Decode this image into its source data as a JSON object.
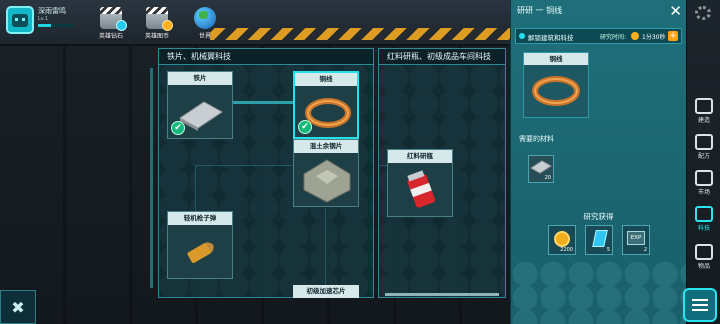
{
  "player": {
    "name": "深雨雷鸣",
    "level": "Lv.1",
    "xp_fraction": 0.35
  },
  "topbar": [
    {
      "label": "英雄钻石",
      "icon": "clapperboard-diamond-icon"
    },
    {
      "label": "英雄图币",
      "icon": "clapperboard-coin-icon"
    },
    {
      "label": "世界",
      "icon": "globe-icon"
    }
  ],
  "panels": {
    "left_title": "铁片、机械翼科技",
    "right_title": "红料研瓶、初级成品车间科技"
  },
  "nodes": {
    "iron_sheet": "铁片",
    "wire": "铜线",
    "concrete": "混土余钢片",
    "bullet": "轻机枪子弹",
    "accel": "初级加速芯片",
    "red_bottle": "红料研瓶"
  },
  "detail": {
    "title": "研研 一 铜线",
    "unlock_label": "解锁建筑和科技",
    "time_label": "研究时间:",
    "time_value": "1分30秒",
    "item_name": "铜线",
    "materials_label": "需要的材料",
    "material_qty": "20",
    "reward_title": "研究获得",
    "rewards": [
      {
        "icon": "gold-coin-icon",
        "qty": "2200"
      },
      {
        "icon": "blue-crystal-icon",
        "qty": "5"
      },
      {
        "icon": "exp-chip-icon",
        "qty": "2",
        "text": "EXP"
      }
    ]
  },
  "sidenav": [
    {
      "label": "建造",
      "icon": "build-icon"
    },
    {
      "label": "配方",
      "icon": "recipe-icon"
    },
    {
      "label": "市场",
      "icon": "market-icon"
    },
    {
      "label": "科技",
      "icon": "tech-icon",
      "active": true
    },
    {
      "label": "物品",
      "icon": "items-icon"
    }
  ]
}
